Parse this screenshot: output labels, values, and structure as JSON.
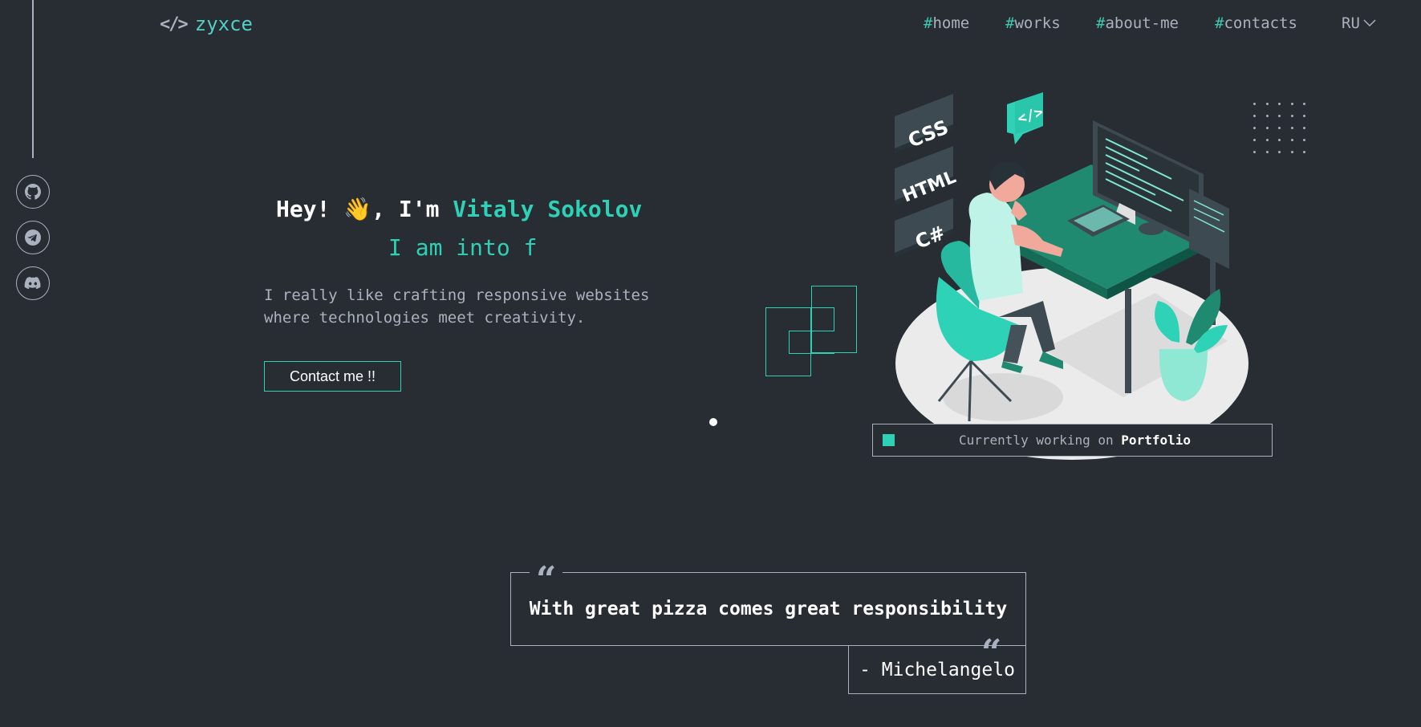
{
  "header": {
    "logo_text": "zyxce",
    "logo_mark": "</>",
    "nav": [
      {
        "hash": "#",
        "label": "home"
      },
      {
        "hash": "#",
        "label": "works"
      },
      {
        "hash": "#",
        "label": "about-me"
      },
      {
        "hash": "#",
        "label": "contacts"
      }
    ],
    "language": "RU"
  },
  "social": [
    {
      "icon": "github-icon"
    },
    {
      "icon": "telegram-icon"
    },
    {
      "icon": "discord-icon"
    }
  ],
  "hero": {
    "greeting_prefix": "Hey!",
    "greeting_emoji": "👋",
    "greeting_mid": ", I'm",
    "name": "Vitaly Sokolov",
    "typing": "I am into f",
    "description": "I really like crafting responsive websites where technologies meet creativity.",
    "contact_button": "Contact me !!"
  },
  "illustration": {
    "tags": [
      "CSS",
      "HTML",
      "C#"
    ],
    "code_badge": "</>"
  },
  "status": {
    "prefix": "Currently working on",
    "project": "Portfolio"
  },
  "quote": {
    "text": "With great pizza comes great responsibility",
    "author": "- Michelangelo",
    "mark": "“"
  },
  "colors": {
    "background": "#282c33",
    "accent": "#2fd1b6",
    "text": "#abb2bf",
    "heading": "#ffffff"
  }
}
